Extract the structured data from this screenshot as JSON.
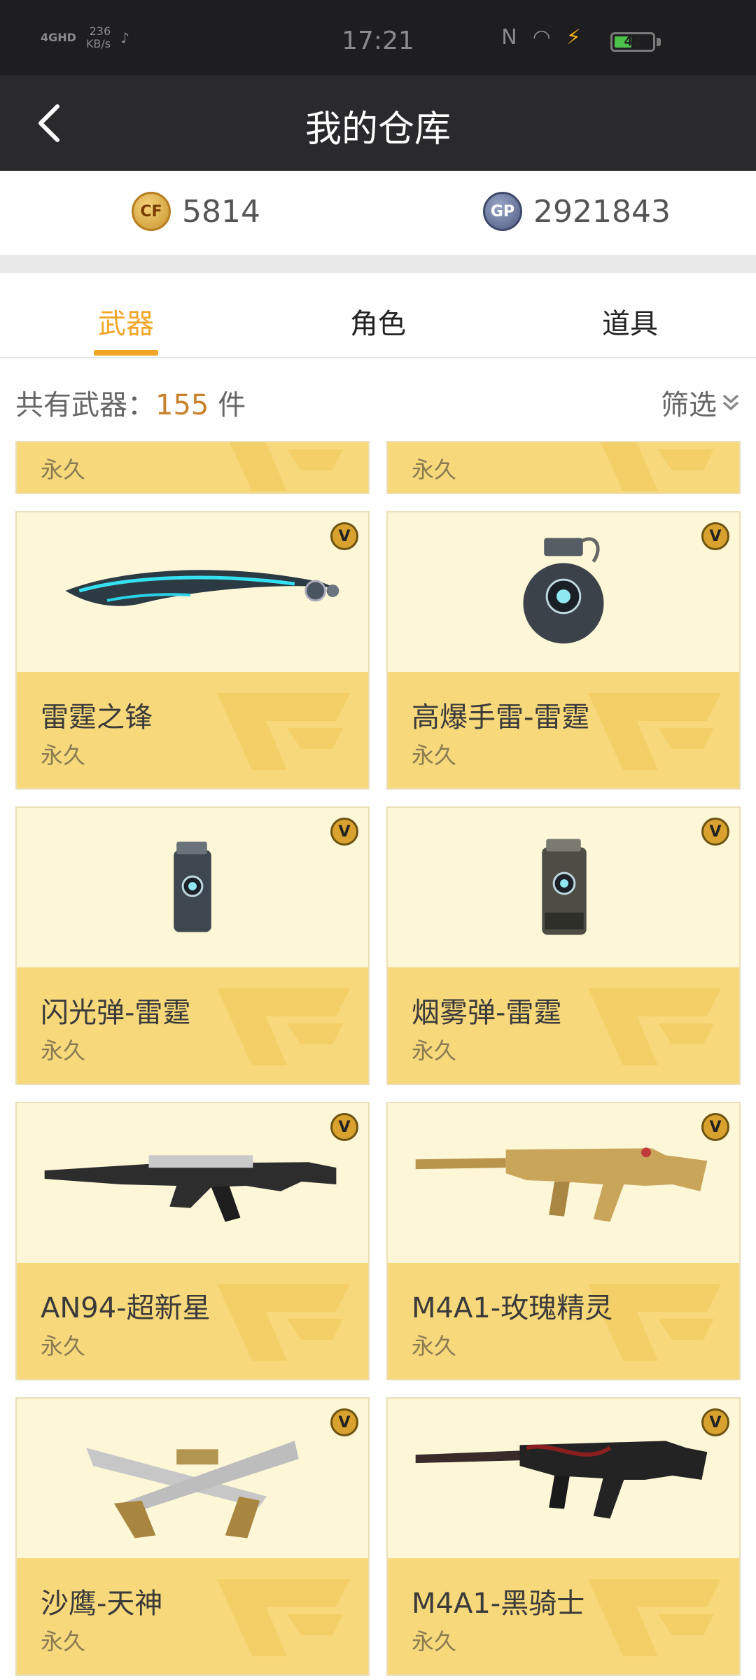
{
  "status_bar": {
    "network": "4GHD",
    "speed_value": "236",
    "speed_unit": "KB/s",
    "time": "17:21",
    "battery": "42"
  },
  "header": {
    "title": "我的仓库"
  },
  "currency": {
    "cf_points": "5814",
    "gp_points": "2921843",
    "cf_icon_text": "CF",
    "gp_icon_text": "GP"
  },
  "tabs": [
    {
      "label": "武器",
      "active": true
    },
    {
      "label": "角色",
      "active": false
    },
    {
      "label": "道具",
      "active": false
    }
  ],
  "summary": {
    "count_label": "共有武器：",
    "count_value": "155",
    "count_unit": " 件",
    "filter_label": "筛选"
  },
  "partial_items": [
    {
      "duration": "永久"
    },
    {
      "duration": "永久"
    }
  ],
  "items": [
    {
      "name": "雷霆之锋",
      "duration": "永久",
      "badge": "V",
      "icon": "thunder-blade-knife-icon"
    },
    {
      "name": "高爆手雷-雷霆",
      "duration": "永久",
      "badge": "V",
      "icon": "grenade-icon"
    },
    {
      "name": "闪光弹-雷霆",
      "duration": "永久",
      "badge": "V",
      "icon": "flashbang-icon"
    },
    {
      "name": "烟雾弹-雷霆",
      "duration": "永久",
      "badge": "V",
      "icon": "smoke-grenade-icon"
    },
    {
      "name": "AN94-超新星",
      "duration": "永久",
      "badge": "V",
      "icon": "assault-rifle-icon"
    },
    {
      "name": "M4A1-玫瑰精灵",
      "duration": "永久",
      "badge": "V",
      "icon": "golden-rifle-icon"
    },
    {
      "name": "沙鹰-天神",
      "duration": "永久",
      "badge": "V",
      "icon": "dual-pistols-icon"
    },
    {
      "name": "M4A1-黑骑士",
      "duration": "永久",
      "badge": "V",
      "icon": "black-rifle-icon"
    }
  ]
}
